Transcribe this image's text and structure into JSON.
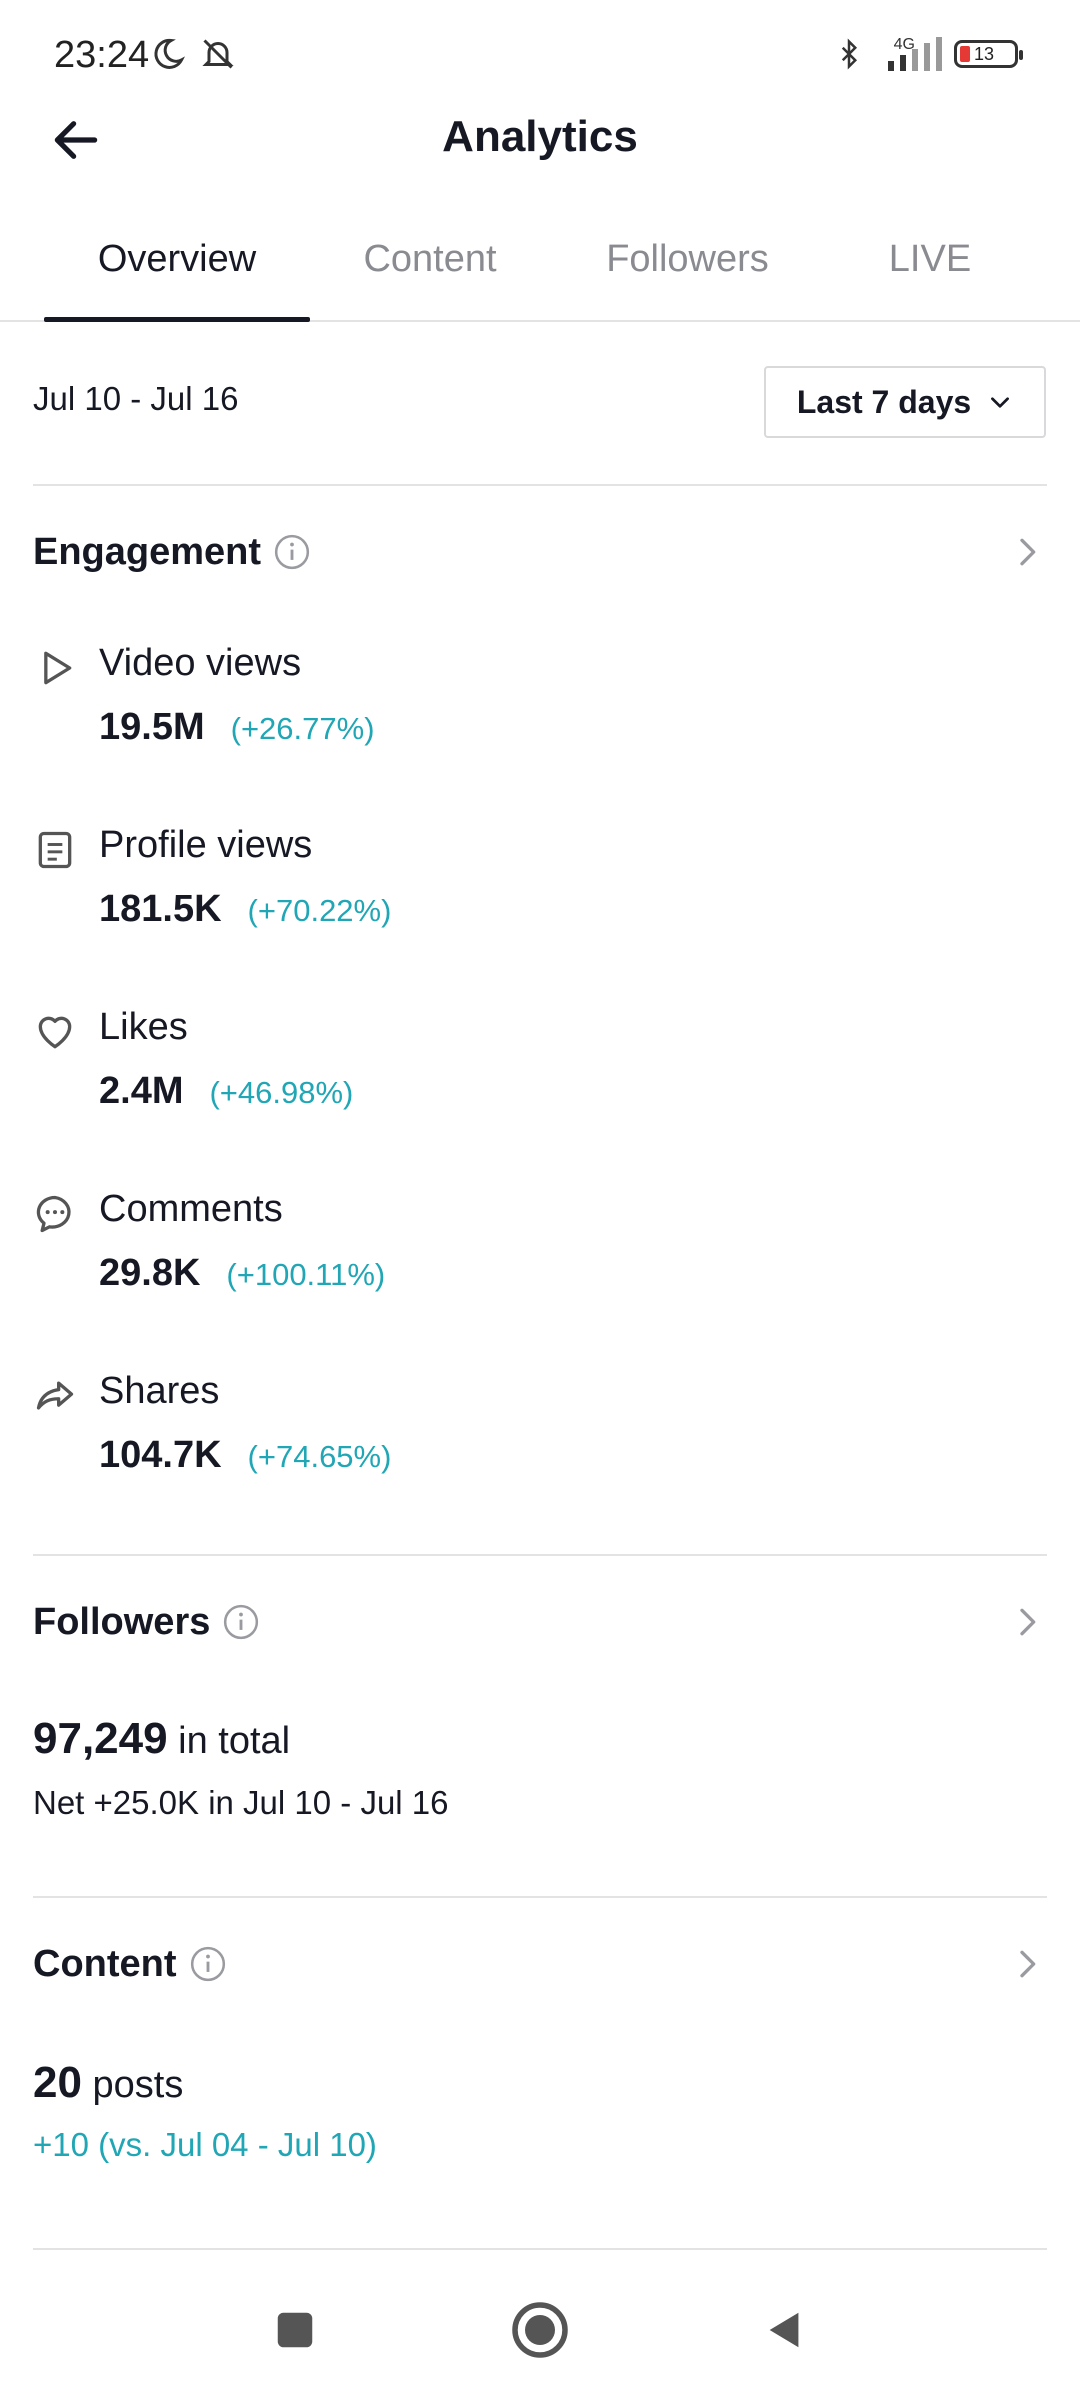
{
  "status_bar": {
    "time": "23:24",
    "network": "4G",
    "battery": "13"
  },
  "header": {
    "title": "Analytics"
  },
  "tabs": [
    {
      "label": "Overview",
      "active": true
    },
    {
      "label": "Content",
      "active": false
    },
    {
      "label": "Followers",
      "active": false
    },
    {
      "label": "LIVE",
      "active": false
    }
  ],
  "date_range": "Jul 10 - Jul 16",
  "period_select": {
    "value": "Last 7 days"
  },
  "engagement": {
    "title": "Engagement",
    "metrics": [
      {
        "icon": "play-icon",
        "label": "Video views",
        "value": "19.5M",
        "change": "(+26.77%)"
      },
      {
        "icon": "profile-doc-icon",
        "label": "Profile views",
        "value": "181.5K",
        "change": "(+70.22%)"
      },
      {
        "icon": "heart-icon",
        "label": "Likes",
        "value": "2.4M",
        "change": "(+46.98%)"
      },
      {
        "icon": "comment-icon",
        "label": "Comments",
        "value": "29.8K",
        "change": "(+100.11%)"
      },
      {
        "icon": "share-icon",
        "label": "Shares",
        "value": "104.7K",
        "change": "(+74.65%)"
      }
    ]
  },
  "followers": {
    "title": "Followers",
    "total_value": "97,249",
    "total_suffix": "in total",
    "net": "Net +25.0K in Jul 10 - Jul 16"
  },
  "content": {
    "title": "Content",
    "posts_value": "20",
    "posts_suffix": "posts",
    "comparison": "+10 (vs. Jul 04 - Jul 10)"
  },
  "colors": {
    "accent_teal": "#20a6b5",
    "text_primary": "#161823",
    "text_secondary": "#8a8b91"
  }
}
